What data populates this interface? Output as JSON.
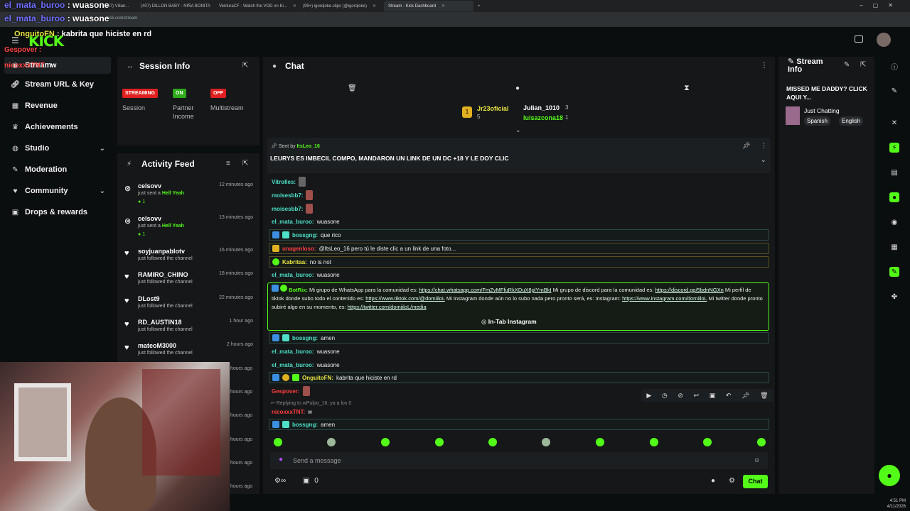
{
  "browser": {
    "tabs": [
      {
        "label": "(407) Villan..."
      },
      {
        "label": "(407) DILLON BABY - NIÑA BONITA"
      },
      {
        "label": "VenturaCF - Watch the VOD on Ki..."
      },
      {
        "label": "(99+) igorqloke.clips (@igorqloke)"
      },
      {
        "label": "Stream - Kick Dashboard"
      }
    ],
    "url": "kick.com/stream"
  },
  "overlay": {
    "line1_user": "el_mata_buroo",
    "line1_text": "wuasone",
    "line2_user": "OnguitoFN",
    "line2_text": "kabrita que hiciste en rd",
    "line3_user": "Gespover",
    "line4_user": "nicoxxxTNT",
    "line4_text": "w"
  },
  "kick": {
    "logo": "KICK"
  },
  "sidebar": {
    "items": [
      {
        "label": "Stream"
      },
      {
        "label": "Stream URL & Key"
      },
      {
        "label": "Revenue"
      },
      {
        "label": "Achievements"
      },
      {
        "label": "Studio"
      },
      {
        "label": "Moderation"
      },
      {
        "label": "Community"
      },
      {
        "label": "Drops & rewards"
      }
    ]
  },
  "session": {
    "title": "Session Info",
    "status": [
      {
        "badge": "STREAMING",
        "label": "Session",
        "color": "#e02020"
      },
      {
        "badge": "ON",
        "label": "Partner Income",
        "color": "#2faa1a"
      },
      {
        "badge": "OFF",
        "label": "Multistream",
        "color": "#e02020"
      }
    ]
  },
  "activity": {
    "title": "Activity Feed",
    "items": [
      {
        "name": "celsovv",
        "desc": "just sent a",
        "gift": "Hell Yeah",
        "time": "12 minutes ago",
        "count": "1"
      },
      {
        "name": "celsovv",
        "desc": "just sent a",
        "gift": "Hell Yeah",
        "time": "13 minutes ago",
        "count": "1"
      },
      {
        "name": "soyjuanpablotv",
        "desc": "just followed the channel",
        "time": "16 minutes ago"
      },
      {
        "name": "RAMIRO_CHINO",
        "desc": "just followed the channel",
        "time": "18 minutes ago"
      },
      {
        "name": "DLost9",
        "desc": "just followed the channel",
        "time": "22 minutes ago"
      },
      {
        "name": "RD_AUSTIN18",
        "desc": "just followed the channel",
        "time": "1 hour ago"
      },
      {
        "name": "mateoM3000",
        "desc": "just followed the channel",
        "time": "2 hours ago"
      }
    ],
    "more_times": [
      "hours ago",
      "hours ago",
      "hours ago",
      "hours ago",
      "hours ago",
      "hours ago"
    ]
  },
  "chat": {
    "title": "Chat",
    "top_users": [
      {
        "name": "Jr23oficial",
        "count": "5"
      },
      {
        "name": "Julian_1010",
        "count": "3"
      },
      {
        "name": "luisazcona18",
        "count": "1"
      }
    ],
    "pinned": {
      "sent_by_label": "Sent by",
      "user": "ItsLeo_16",
      "text": "LEURYS ES IMBECIL COMPO, MANDARON UN LINK DE UN DC +18 Y LE DOY CLIC"
    },
    "messages": [
      {
        "user": "Vitrolles:",
        "text": ""
      },
      {
        "user": "moisesbb7:",
        "text": ""
      },
      {
        "user": "moisesbb7:",
        "text": ""
      },
      {
        "user": "el_mata_buroo:",
        "text": "wuasone"
      },
      {
        "user": "bossgng:",
        "text": "que rico"
      },
      {
        "user": "unagenloso:",
        "text": "@ItsLeo_16 pero tú le diste clic a un link de una foto..."
      },
      {
        "user": "Kabritaa:",
        "text": "no is not"
      },
      {
        "user": "el_mata_buroo:",
        "text": "wuasone"
      },
      {
        "user": "bossgng:",
        "text": "amen"
      },
      {
        "user": "el_mata_buroo:",
        "text": "wuasone"
      },
      {
        "user": "el_mata_buroo:",
        "text": "wuasone"
      },
      {
        "user": "OnguitoFN:",
        "text": "kabrita que hiciste en rd"
      },
      {
        "user": "Gespover:",
        "text": ""
      },
      {
        "user": "nicoxxxTNT:",
        "text": "w"
      },
      {
        "user": "bossgng:",
        "text": "amen"
      }
    ],
    "botrix": {
      "user": "BotRix:",
      "t1": "Mi grupo de WhatsApp para la comunidad es:",
      "l1": "https://chat.whatsapp.com/FmZvMFfuRkXDuX8plYmBkI",
      "t2": "Mi grupo de discord para la comunidad es:",
      "l2": "https://discord.gg/5bdnNGXn",
      "t3": "Mi perfil de tiktok donde subo todo el contenido es:",
      "l3": "https://www.tiktok.com/@domiiloL",
      "t4": "Mi Instagram donde aún no lo subo nada pero pronto será, es: Instagram:",
      "l4": "https://www.instagram.com/domiiloL",
      "t5": "Mi twitter donde pronto subiré algo en su momento, es:",
      "l5": "https://twitter.com/domiiloL/media",
      "button": "In-Tab Instagram"
    },
    "reply_text": "Replying to wPulpo_16: ya a los 0",
    "input_placeholder": "Send a message",
    "send_label": "Chat",
    "viewer_count": "0"
  },
  "stream_info": {
    "title": "Stream Info",
    "stream_title": "MISSED ME DADDY? CLICK AQUI Y...",
    "category": "Just Chatting",
    "tags": [
      "Spanish",
      "English"
    ]
  },
  "taskbar": {
    "time": "4:51 PM",
    "date": "4/11/2026"
  },
  "colors": {
    "accent": "#53fc18",
    "panel": "#151719",
    "bg": "#0b0e0f",
    "danger": "#e02020"
  }
}
